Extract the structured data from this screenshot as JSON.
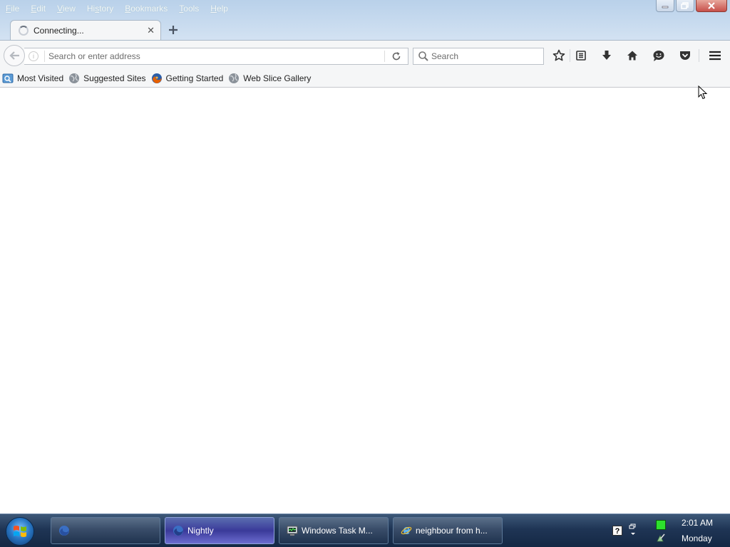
{
  "menubar": {
    "items": [
      {
        "pre": "",
        "acc": "F",
        "post": "ile"
      },
      {
        "pre": "",
        "acc": "E",
        "post": "dit"
      },
      {
        "pre": "",
        "acc": "V",
        "post": "iew"
      },
      {
        "pre": "Hi",
        "acc": "s",
        "post": "tory"
      },
      {
        "pre": "",
        "acc": "B",
        "post": "ookmarks"
      },
      {
        "pre": "",
        "acc": "T",
        "post": "ools"
      },
      {
        "pre": "",
        "acc": "H",
        "post": "elp"
      }
    ]
  },
  "tab": {
    "title": "Connecting..."
  },
  "navbar": {
    "url_placeholder": "Search or enter address",
    "search_placeholder": "Search"
  },
  "bookmarks": [
    {
      "label": "Most Visited",
      "icon": "most-visited-icon"
    },
    {
      "label": "Suggested Sites",
      "icon": "globe-icon"
    },
    {
      "label": "Getting Started",
      "icon": "firefox-icon"
    },
    {
      "label": "Web Slice Gallery",
      "icon": "globe-icon"
    }
  ],
  "taskbar": {
    "buttons": [
      {
        "label": "",
        "icon": "firefox-icon",
        "active": false
      },
      {
        "label": "Nightly",
        "icon": "firefox-icon",
        "active": true
      },
      {
        "label": "Windows Task M...",
        "icon": "task-manager-icon",
        "active": false
      },
      {
        "label": "neighbour from h...",
        "icon": "ie-icon",
        "active": false
      }
    ],
    "clock_time": "2:01 AM",
    "clock_day": "Monday"
  },
  "colors": {
    "titlebar": "#c8dbef",
    "toolbar": "#f5f6f7",
    "taskbar": "#1f3555",
    "active_task": "#3a3a9a"
  }
}
